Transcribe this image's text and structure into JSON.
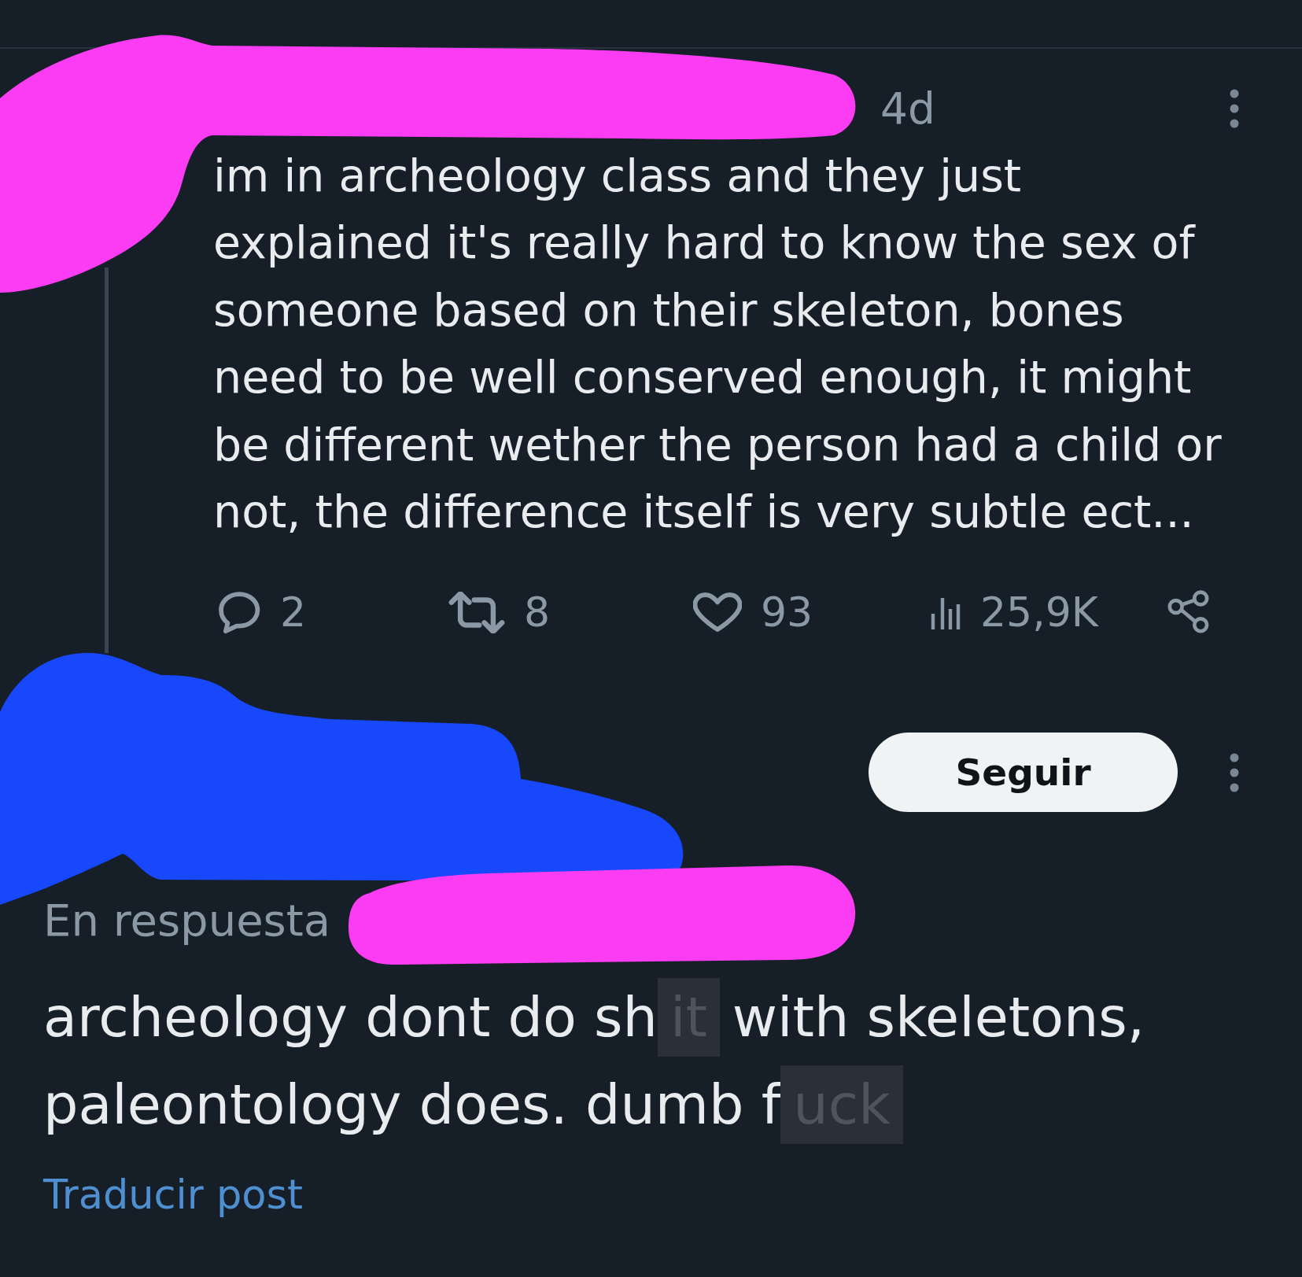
{
  "post": {
    "time": "4d",
    "text_lines": [
      "im in archeology class and they just",
      "explained it's really hard to know the sex of",
      "someone based on their skeleton, bones",
      "need to be well conserved enough, it might",
      "be different wether the person had a child or",
      "not, the difference itself is very subtle ect..."
    ],
    "actions": [
      {
        "kind": "reply",
        "count": "2"
      },
      {
        "kind": "repost",
        "count": "8"
      },
      {
        "kind": "like",
        "count": "93"
      },
      {
        "kind": "views",
        "count": "25,9K"
      },
      {
        "kind": "share"
      }
    ]
  },
  "reply": {
    "follow_button": "Seguir",
    "context": "En respuesta",
    "lines": [
      {
        "segments": [
          {
            "kind": "text",
            "text": "archeology dont do sh"
          },
          {
            "kind": "censored",
            "text": "it"
          },
          {
            "kind": "text",
            "text": "with skeletons,"
          }
        ]
      },
      {
        "segments": [
          {
            "kind": "text",
            "text": "paleontology does. dumb f"
          },
          {
            "kind": "censored",
            "text": "uck"
          }
        ]
      }
    ],
    "translate_link": "Traducir post"
  }
}
